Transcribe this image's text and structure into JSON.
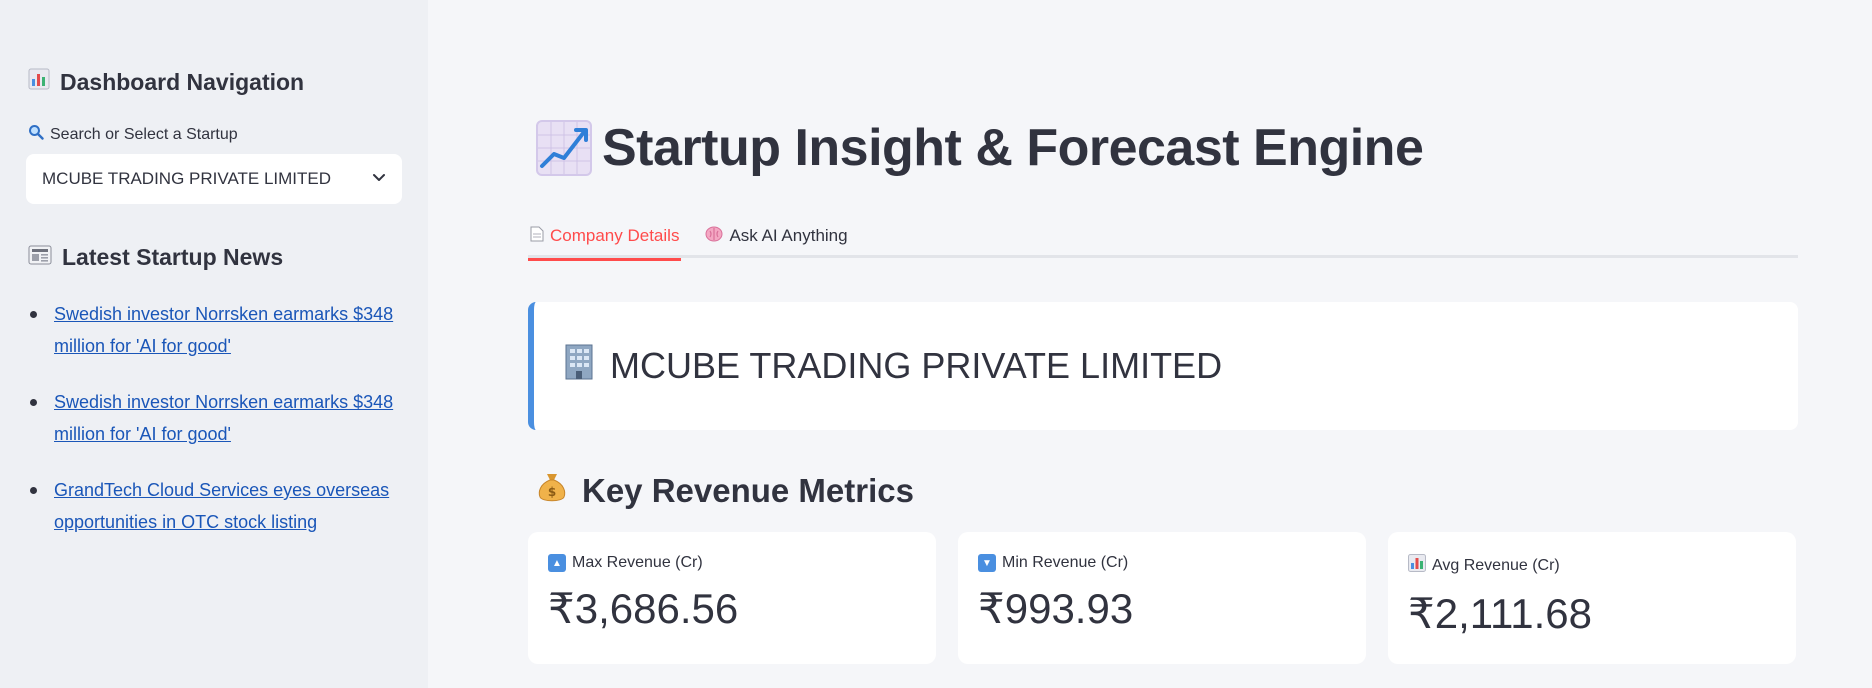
{
  "sidebar": {
    "nav_heading": "Dashboard Navigation",
    "search_label": "Search or Select a Startup",
    "selected_startup": "MCUBE TRADING PRIVATE LIMITED",
    "news_heading": "Latest Startup News",
    "news": [
      {
        "title": "Swedish investor Norrsken earmarks $348 million for 'AI for good'"
      },
      {
        "title": "Swedish investor Norrsken earmarks $348 million for 'AI for good'"
      },
      {
        "title": "GrandTech Cloud Services eyes overseas opportunities in OTC stock listing"
      }
    ]
  },
  "main": {
    "title": "Startup Insight & Forecast Engine",
    "tabs": [
      {
        "label": "Company Details",
        "active": true
      },
      {
        "label": "Ask AI Anything",
        "active": false
      }
    ],
    "company_name": "MCUBE TRADING PRIVATE LIMITED",
    "metrics_heading": "Key Revenue Metrics",
    "metrics": [
      {
        "label": "Max Revenue (Cr)",
        "value": "₹3,686.56"
      },
      {
        "label": "Min Revenue (Cr)",
        "value": "₹993.93"
      },
      {
        "label": "Avg Revenue (Cr)",
        "value": "₹2,111.68"
      }
    ]
  },
  "colors": {
    "accent": "#ff4b4b",
    "link": "#1a56b8",
    "card_border": "#4a8fe0"
  },
  "icons": {
    "nav": "bar-chart-icon",
    "search": "magnifier-icon",
    "news": "newspaper-icon",
    "title": "chart-increasing-icon",
    "company": "office-building-icon",
    "metrics": "money-bag-icon"
  }
}
